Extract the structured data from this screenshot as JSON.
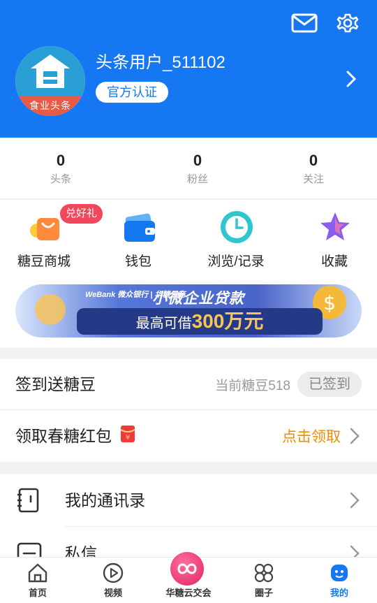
{
  "profile": {
    "username": "头条用户_511102",
    "verify_label": "官方认证",
    "avatar_text": "食业头条"
  },
  "stats": [
    {
      "value": "0",
      "label": "头条"
    },
    {
      "value": "0",
      "label": "粉丝"
    },
    {
      "value": "0",
      "label": "关注"
    }
  ],
  "quick": {
    "badge": "兑好礼",
    "items": [
      {
        "label": "糖豆商城",
        "icon": "shopping-bag-icon"
      },
      {
        "label": "钱包",
        "icon": "wallet-icon"
      },
      {
        "label": "浏览/记录",
        "icon": "clock-icon"
      },
      {
        "label": "收藏",
        "icon": "star-icon"
      }
    ]
  },
  "banner": {
    "brand": "WeBank 微众银行 | 华糖云商",
    "title": "小微企业贷款",
    "sub_prefix": "最高可借",
    "sub_amount": "300万元"
  },
  "checkin": {
    "title": "签到送糖豆",
    "beans": "当前糖豆518",
    "button": "已签到"
  },
  "redpacket": {
    "title": "领取春糖红包",
    "action": "点击领取"
  },
  "list": [
    {
      "label": "我的通讯录",
      "icon": "contacts-book-icon"
    },
    {
      "label": "私信",
      "icon": "message-icon"
    }
  ],
  "tabs": [
    {
      "label": "首页",
      "icon": "home-icon"
    },
    {
      "label": "视频",
      "icon": "play-icon"
    },
    {
      "label": "华糖云交会",
      "icon": "expo-icon"
    },
    {
      "label": "圈子",
      "icon": "circles-icon"
    },
    {
      "label": "我的",
      "icon": "profile-icon"
    }
  ],
  "colors": {
    "brand_blue": "#1677f2",
    "badge_red": "#f2475a",
    "claim_orange": "#f08c00"
  }
}
